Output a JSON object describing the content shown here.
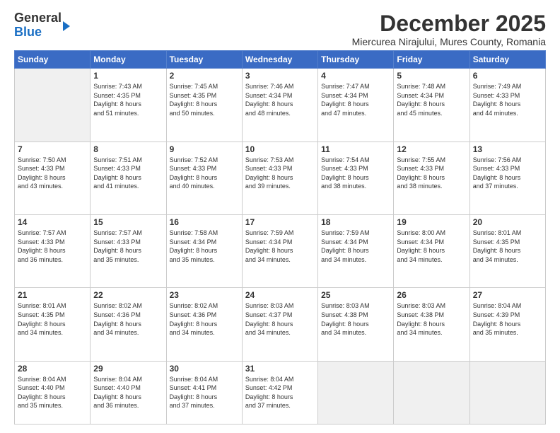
{
  "logo": {
    "line1": "General",
    "line2": "Blue"
  },
  "title": "December 2025",
  "subtitle": "Miercurea Nirajului, Mures County, Romania",
  "days_header": [
    "Sunday",
    "Monday",
    "Tuesday",
    "Wednesday",
    "Thursday",
    "Friday",
    "Saturday"
  ],
  "weeks": [
    [
      {
        "day": "",
        "info": ""
      },
      {
        "day": "1",
        "info": "Sunrise: 7:43 AM\nSunset: 4:35 PM\nDaylight: 8 hours\nand 51 minutes."
      },
      {
        "day": "2",
        "info": "Sunrise: 7:45 AM\nSunset: 4:35 PM\nDaylight: 8 hours\nand 50 minutes."
      },
      {
        "day": "3",
        "info": "Sunrise: 7:46 AM\nSunset: 4:34 PM\nDaylight: 8 hours\nand 48 minutes."
      },
      {
        "day": "4",
        "info": "Sunrise: 7:47 AM\nSunset: 4:34 PM\nDaylight: 8 hours\nand 47 minutes."
      },
      {
        "day": "5",
        "info": "Sunrise: 7:48 AM\nSunset: 4:34 PM\nDaylight: 8 hours\nand 45 minutes."
      },
      {
        "day": "6",
        "info": "Sunrise: 7:49 AM\nSunset: 4:33 PM\nDaylight: 8 hours\nand 44 minutes."
      }
    ],
    [
      {
        "day": "7",
        "info": "Sunrise: 7:50 AM\nSunset: 4:33 PM\nDaylight: 8 hours\nand 43 minutes."
      },
      {
        "day": "8",
        "info": "Sunrise: 7:51 AM\nSunset: 4:33 PM\nDaylight: 8 hours\nand 41 minutes."
      },
      {
        "day": "9",
        "info": "Sunrise: 7:52 AM\nSunset: 4:33 PM\nDaylight: 8 hours\nand 40 minutes."
      },
      {
        "day": "10",
        "info": "Sunrise: 7:53 AM\nSunset: 4:33 PM\nDaylight: 8 hours\nand 39 minutes."
      },
      {
        "day": "11",
        "info": "Sunrise: 7:54 AM\nSunset: 4:33 PM\nDaylight: 8 hours\nand 38 minutes."
      },
      {
        "day": "12",
        "info": "Sunrise: 7:55 AM\nSunset: 4:33 PM\nDaylight: 8 hours\nand 38 minutes."
      },
      {
        "day": "13",
        "info": "Sunrise: 7:56 AM\nSunset: 4:33 PM\nDaylight: 8 hours\nand 37 minutes."
      }
    ],
    [
      {
        "day": "14",
        "info": "Sunrise: 7:57 AM\nSunset: 4:33 PM\nDaylight: 8 hours\nand 36 minutes."
      },
      {
        "day": "15",
        "info": "Sunrise: 7:57 AM\nSunset: 4:33 PM\nDaylight: 8 hours\nand 35 minutes."
      },
      {
        "day": "16",
        "info": "Sunrise: 7:58 AM\nSunset: 4:34 PM\nDaylight: 8 hours\nand 35 minutes."
      },
      {
        "day": "17",
        "info": "Sunrise: 7:59 AM\nSunset: 4:34 PM\nDaylight: 8 hours\nand 34 minutes."
      },
      {
        "day": "18",
        "info": "Sunrise: 7:59 AM\nSunset: 4:34 PM\nDaylight: 8 hours\nand 34 minutes."
      },
      {
        "day": "19",
        "info": "Sunrise: 8:00 AM\nSunset: 4:34 PM\nDaylight: 8 hours\nand 34 minutes."
      },
      {
        "day": "20",
        "info": "Sunrise: 8:01 AM\nSunset: 4:35 PM\nDaylight: 8 hours\nand 34 minutes."
      }
    ],
    [
      {
        "day": "21",
        "info": "Sunrise: 8:01 AM\nSunset: 4:35 PM\nDaylight: 8 hours\nand 34 minutes."
      },
      {
        "day": "22",
        "info": "Sunrise: 8:02 AM\nSunset: 4:36 PM\nDaylight: 8 hours\nand 34 minutes."
      },
      {
        "day": "23",
        "info": "Sunrise: 8:02 AM\nSunset: 4:36 PM\nDaylight: 8 hours\nand 34 minutes."
      },
      {
        "day": "24",
        "info": "Sunrise: 8:03 AM\nSunset: 4:37 PM\nDaylight: 8 hours\nand 34 minutes."
      },
      {
        "day": "25",
        "info": "Sunrise: 8:03 AM\nSunset: 4:38 PM\nDaylight: 8 hours\nand 34 minutes."
      },
      {
        "day": "26",
        "info": "Sunrise: 8:03 AM\nSunset: 4:38 PM\nDaylight: 8 hours\nand 34 minutes."
      },
      {
        "day": "27",
        "info": "Sunrise: 8:04 AM\nSunset: 4:39 PM\nDaylight: 8 hours\nand 35 minutes."
      }
    ],
    [
      {
        "day": "28",
        "info": "Sunrise: 8:04 AM\nSunset: 4:40 PM\nDaylight: 8 hours\nand 35 minutes."
      },
      {
        "day": "29",
        "info": "Sunrise: 8:04 AM\nSunset: 4:40 PM\nDaylight: 8 hours\nand 36 minutes."
      },
      {
        "day": "30",
        "info": "Sunrise: 8:04 AM\nSunset: 4:41 PM\nDaylight: 8 hours\nand 37 minutes."
      },
      {
        "day": "31",
        "info": "Sunrise: 8:04 AM\nSunset: 4:42 PM\nDaylight: 8 hours\nand 37 minutes."
      },
      {
        "day": "",
        "info": ""
      },
      {
        "day": "",
        "info": ""
      },
      {
        "day": "",
        "info": ""
      }
    ]
  ]
}
